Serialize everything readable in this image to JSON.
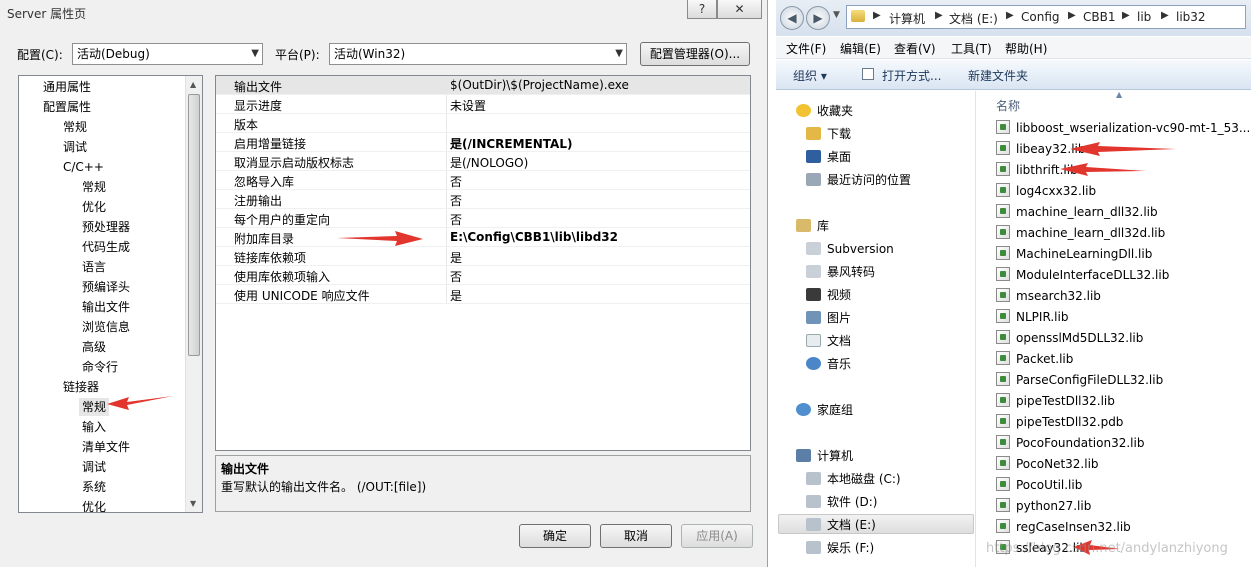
{
  "dialog": {
    "title": "Server 属性页",
    "help_label": "?",
    "close_label": "✕",
    "config_label": "配置(C):",
    "config_value": "活动(Debug)",
    "platform_label": "平台(P):",
    "platform_value": "活动(Win32)",
    "config_manager_label": "配置管理器(O)...",
    "tree": [
      "通用属性",
      "配置属性",
      "常规",
      "调试",
      "C/C++",
      "常规",
      "优化",
      "预处理器",
      "代码生成",
      "语言",
      "预编译头",
      "输出文件",
      "浏览信息",
      "高级",
      "命令行",
      "链接器",
      "常规",
      "输入",
      "清单文件",
      "调试",
      "系统",
      "优化"
    ],
    "properties": [
      {
        "name": "输出文件",
        "value": "$(OutDir)\\$(ProjectName).exe",
        "bold": false
      },
      {
        "name": "显示进度",
        "value": "未设置",
        "bold": false
      },
      {
        "name": "版本",
        "value": "",
        "bold": false
      },
      {
        "name": "启用增量链接",
        "value": "是(/INCREMENTAL)",
        "bold": true
      },
      {
        "name": "取消显示启动版权标志",
        "value": "是(/NOLOGO)",
        "bold": false
      },
      {
        "name": "忽略导入库",
        "value": "否",
        "bold": false
      },
      {
        "name": "注册输出",
        "value": "否",
        "bold": false
      },
      {
        "name": "每个用户的重定向",
        "value": "否",
        "bold": false
      },
      {
        "name": "附加库目录",
        "value": "E:\\Config\\CBB1\\lib\\libd32",
        "bold": true
      },
      {
        "name": "链接库依赖项",
        "value": "是",
        "bold": false
      },
      {
        "name": "使用库依赖项输入",
        "value": "否",
        "bold": false
      },
      {
        "name": "使用 UNICODE 响应文件",
        "value": "是",
        "bold": false
      }
    ],
    "desc_title": "输出文件",
    "desc_text": "重写默认的输出文件名。     (/OUT:[file])",
    "ok_label": "确定",
    "cancel_label": "取消",
    "apply_label": "应用(A)"
  },
  "explorer": {
    "breadcrumb": [
      "计算机",
      "文档 (E:)",
      "Config",
      "CBB1",
      "lib",
      "lib32"
    ],
    "menu": [
      "文件(F)",
      "编辑(E)",
      "查看(V)",
      "工具(T)",
      "帮助(H)"
    ],
    "toolbar": {
      "organize": "组织 ▾",
      "open": "打开方式...",
      "new_folder": "新建文件夹"
    },
    "nav": {
      "favorites": "收藏夹",
      "downloads": "下载",
      "desktop": "桌面",
      "recent": "最近访问的位置",
      "libraries": "库",
      "subversion": "Subversion",
      "baofeng": "暴风转码",
      "videos": "视频",
      "pictures": "图片",
      "documents": "文档",
      "music": "音乐",
      "homegroup": "家庭组",
      "computer": "计算机",
      "drive_c": "本地磁盘 (C:)",
      "drive_d": "软件 (D:)",
      "drive_e": "文档 (E:)",
      "drive_f": "娱乐 (F:)"
    },
    "column_name": "名称",
    "files": [
      "libboost_wserialization-vc90-mt-1_53....",
      "libeay32.lib",
      "libthrift.lib",
      "log4cxx32.lib",
      "machine_learn_dll32.lib",
      "machine_learn_dll32d.lib",
      "MachineLearningDll.lib",
      "ModuleInterfaceDLL32.lib",
      "msearch32.lib",
      "NLPIR.lib",
      "opensslMd5DLL32.lib",
      "Packet.lib",
      "ParseConfigFileDLL32.lib",
      "pipeTestDll32.lib",
      "pipeTestDll32.pdb",
      "PocoFoundation32.lib",
      "PocoNet32.lib",
      "PocoUtil.lib",
      "python27.lib",
      "regCaseInsen32.lib",
      "ssleay32.lib"
    ],
    "watermark": "https://blog.csdn.net/andylanzhiyong"
  },
  "colors": {
    "arrow": "#e2352d",
    "selection": "#e6e6e6"
  }
}
